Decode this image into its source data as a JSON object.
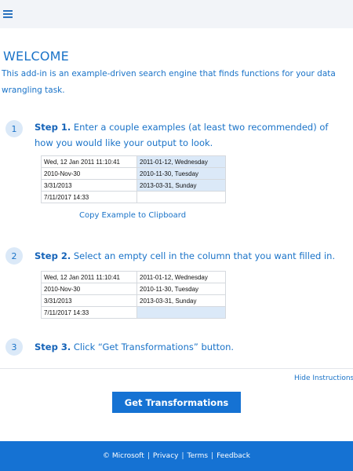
{
  "menu": {
    "icon": "hamburger-menu-icon"
  },
  "welcome": {
    "title": "WELCOME",
    "intro": "This add-in is an example-driven search engine that finds functions for your data wrangling task."
  },
  "steps": [
    {
      "number": "1",
      "title": "Step 1.",
      "text": " Enter a couple examples (at least two recommended) of how you would like your output to look."
    },
    {
      "number": "2",
      "title": "Step 2.",
      "text": " Select an empty cell in the column that you want filled in."
    },
    {
      "number": "3",
      "title": "Step 3.",
      "text": " Click “Get Transformations” button."
    }
  ],
  "example_table_1": {
    "rows": [
      [
        "Wed, 12 Jan 2011 11:10:41",
        "2011-01-12, Wednesday"
      ],
      [
        "2010-Nov-30",
        "2010-11-30, Tuesday"
      ],
      [
        "3/31/2013",
        "2013-03-31, Sunday"
      ],
      [
        "7/11/2017 14:33",
        ""
      ]
    ]
  },
  "example_table_2": {
    "rows": [
      [
        "Wed, 12 Jan 2011 11:10:41",
        "2011-01-12, Wednesday"
      ],
      [
        "2010-Nov-30",
        "2010-11-30, Tuesday"
      ],
      [
        "3/31/2013",
        "2013-03-31, Sunday"
      ],
      [
        "7/11/2017 14:33",
        ""
      ]
    ]
  },
  "copy_link": "Copy Example to Clipboard",
  "hide_link": "Hide Instructions",
  "get_button": "Get Transformations",
  "footer": {
    "copyright": "© Microsoft",
    "separator": "|",
    "privacy": "Privacy",
    "terms": "Terms",
    "feedback": "Feedback"
  },
  "colors": {
    "accent": "#1572d3",
    "text_blue": "#1a73c8",
    "highlight": "#dbe9f8",
    "topbar": "#f2f4f8"
  }
}
